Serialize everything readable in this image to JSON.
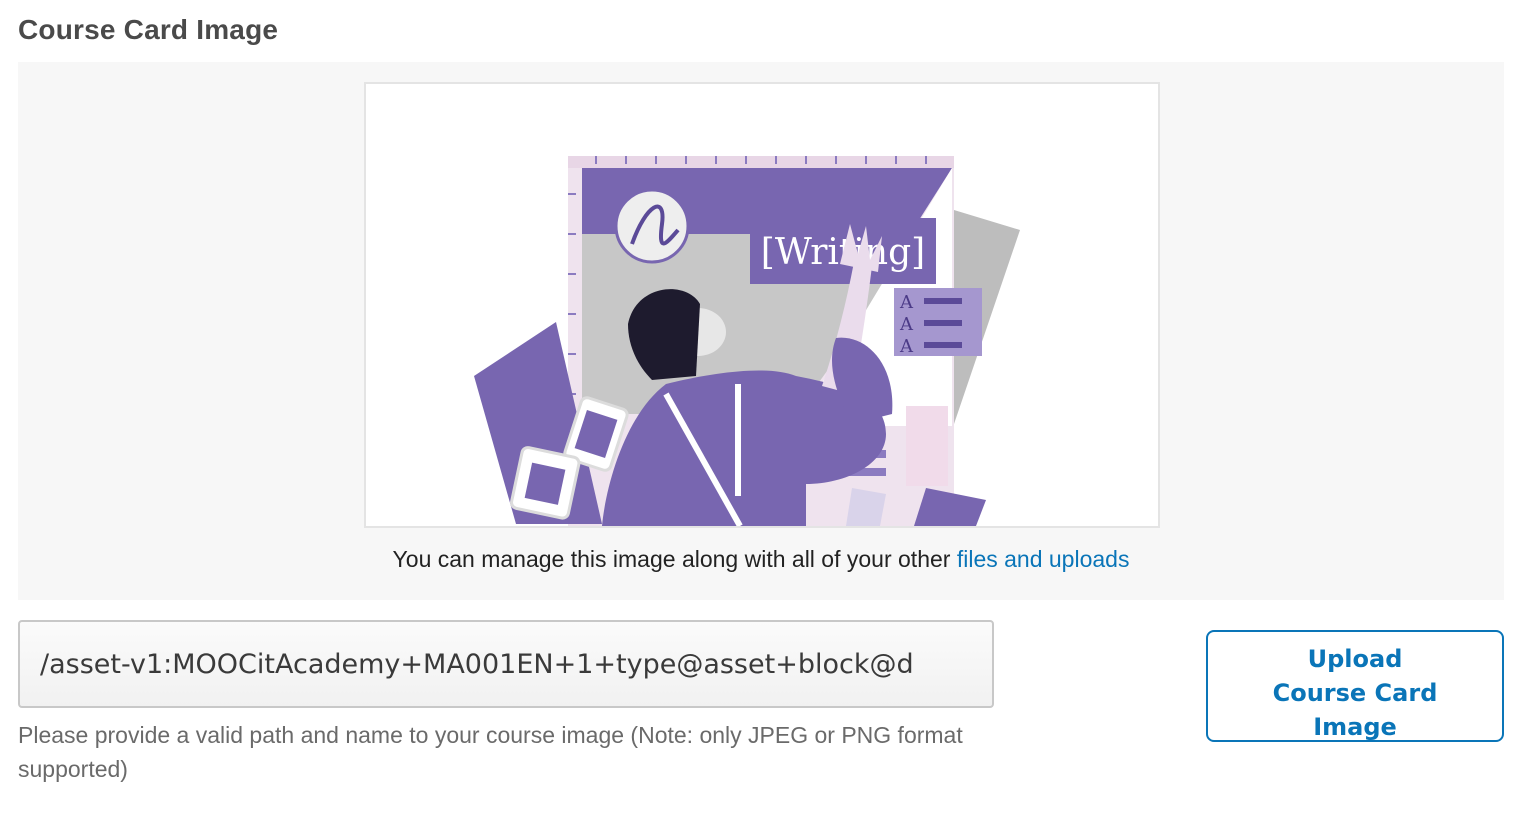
{
  "section": {
    "title": "Course Card Image"
  },
  "preview": {
    "image_alt": "Course card illustration",
    "image_heading_text": "[Writing]",
    "manage_text": "You can manage this image along with all of your other",
    "manage_link": "files and uploads"
  },
  "image_field": {
    "value": "/asset-v1:MOOCitAcademy+MA001EN+1+type@asset+block@d",
    "help_text": "Please provide a valid path and name to your course image (Note: only JPEG or PNG format supported)"
  },
  "upload_button": {
    "label": "Upload Course Card Image"
  },
  "colors": {
    "accent": "#0a75b8",
    "illustration_purple": "#7866b0",
    "panel_background": "#f7f7f7"
  }
}
